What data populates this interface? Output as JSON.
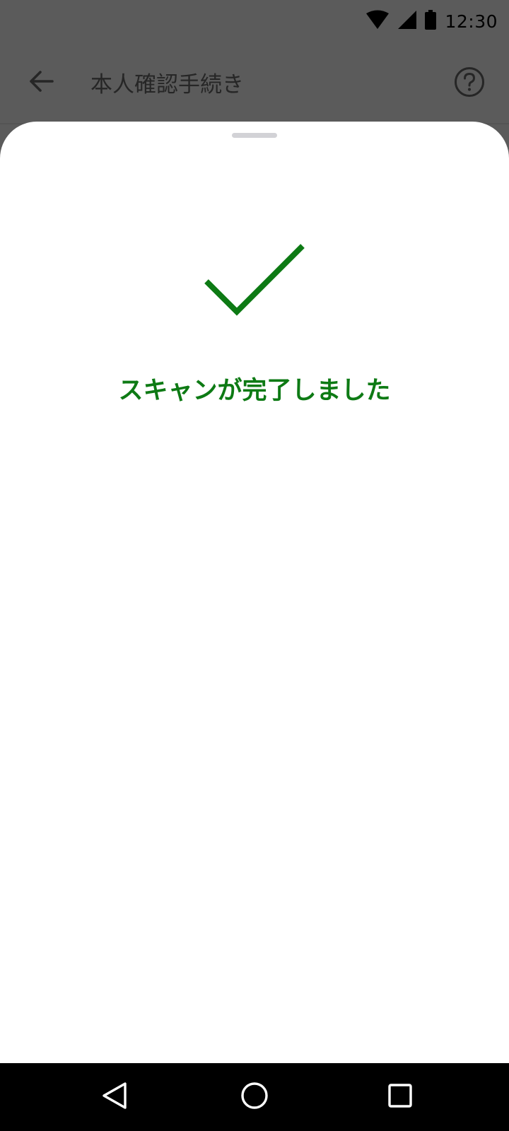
{
  "status_bar": {
    "time": "12:30",
    "icons": [
      "wifi-icon",
      "cellular-signal-icon",
      "battery-icon"
    ]
  },
  "app_bar": {
    "title": "本人確認手続き",
    "back_icon": "arrow-back-icon",
    "help_icon": "help-circle-icon"
  },
  "sheet": {
    "status_icon": "check-icon",
    "message": "スキャンが完了しました"
  },
  "nav_bar": {
    "buttons": [
      "back-triangle-icon",
      "home-circle-icon",
      "recents-square-icon"
    ]
  },
  "colors": {
    "scrim": "#5b5b5b",
    "success_green": "#0d7a14",
    "sheet_background": "#ffffff",
    "nav_background": "#000000"
  }
}
